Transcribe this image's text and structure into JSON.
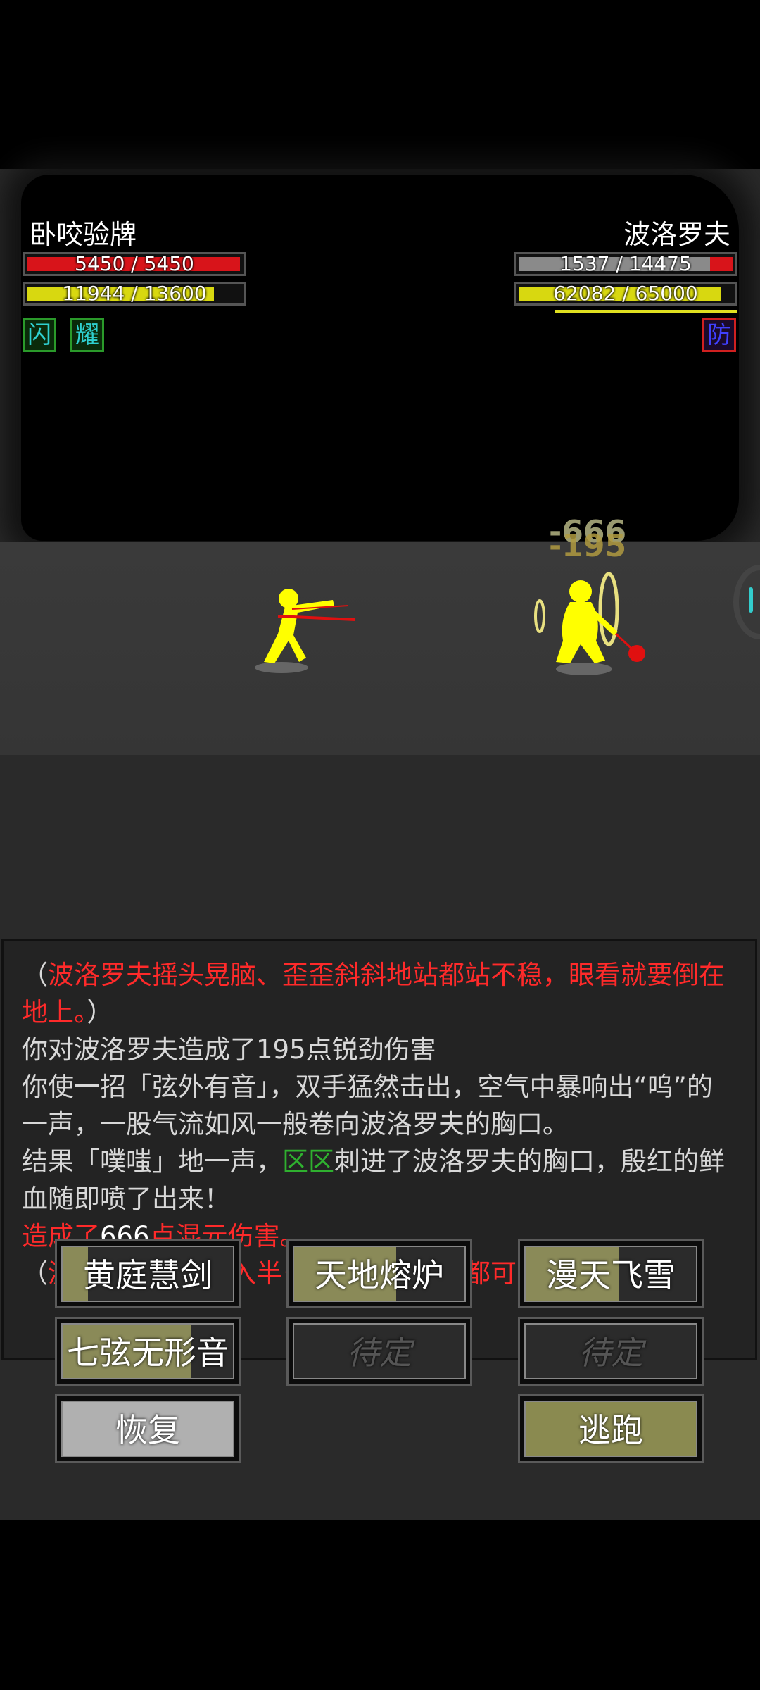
{
  "player": {
    "name": "卧咬验牌",
    "hp": "5450 / 5450",
    "hp_fraction": 1.0,
    "mp": "11944 / 13600",
    "mp_fraction": 0.878,
    "buffs": [
      "闪",
      "耀"
    ]
  },
  "enemy": {
    "name": "波洛罗夫",
    "hp": "1537 / 14475",
    "hp_fraction": 0.106,
    "mp": "62082 / 65000",
    "mp_fraction": 0.955,
    "buffs": [
      "防"
    ]
  },
  "damage_popups": [
    "-666",
    "-195"
  ],
  "log": [
    {
      "segments": [
        {
          "text": "（",
          "c": "normal"
        },
        {
          "text": "波洛罗夫摇头晃脑、歪歪斜斜地站都站不稳，眼看就要倒在地上。",
          "c": "red"
        },
        {
          "text": "）",
          "c": "normal"
        }
      ]
    },
    {
      "segments": [
        {
          "text": "你对波洛罗夫造成了195点锐劲伤害",
          "c": "normal"
        }
      ]
    },
    {
      "segments": [
        {
          "text": "你使一招「弦外有音」，双手猛然击出，空气中暴响出“呜”的一声，一股气流如风一般卷向波洛罗夫的胸口。",
          "c": "normal"
        }
      ]
    },
    {
      "segments": [
        {
          "text": "结果「噗嗤」地一声，",
          "c": "normal"
        },
        {
          "text": "区区",
          "c": "green"
        },
        {
          "text": "刺进了波洛罗夫的胸口，殷红的鲜血随即喷了出来！",
          "c": "normal"
        }
      ]
    },
    {
      "segments": [
        {
          "text": "造成了",
          "c": "red"
        },
        {
          "text": "666",
          "c": "white"
        },
        {
          "text": "点混元伤害。",
          "c": "red"
        }
      ]
    },
    {
      "segments": [
        {
          "text": "（",
          "c": "normal"
        },
        {
          "text": "波洛罗夫已经陷入半昏迷状态，随时都可能摔倒晕去",
          "c": "red"
        },
        {
          "text": "。）",
          "c": "normal"
        }
      ]
    }
  ],
  "skills": [
    {
      "label": "黄庭慧剑",
      "fill": 0.15,
      "enabled": true
    },
    {
      "label": "天地熔炉",
      "fill": 0.6,
      "enabled": true
    },
    {
      "label": "漫天飞雪",
      "fill": 0.55,
      "enabled": true
    },
    {
      "label": "七弦无形音",
      "fill": 0.75,
      "enabled": true
    },
    {
      "label": "待定",
      "fill": 0,
      "enabled": false
    },
    {
      "label": "待定",
      "fill": 0,
      "enabled": false
    }
  ],
  "actions": {
    "recover": "恢复",
    "flee": "逃跑"
  }
}
